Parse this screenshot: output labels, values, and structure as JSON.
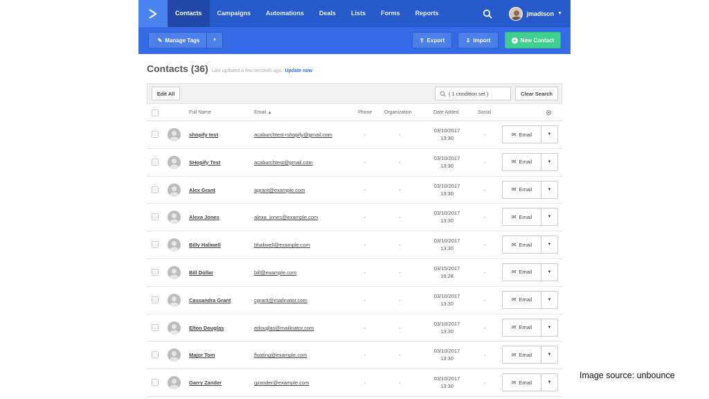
{
  "nav": {
    "items": [
      "Contacts",
      "Campaigns",
      "Automations",
      "Deals",
      "Lists",
      "Forms",
      "Reports"
    ],
    "active": "Contacts",
    "username": "jmadison"
  },
  "toolbar": {
    "manage_tags": "Manage Tags",
    "export": "Export",
    "import": "Import",
    "new_contact": "New Contact"
  },
  "page": {
    "title": "Contacts (36)",
    "updated": "Last updated a few seconds ago.",
    "update_link": "Update now"
  },
  "filter": {
    "edit_all": "Edit All",
    "condition": "( 1 condition set )",
    "clear_search": "Clear Search"
  },
  "columns": {
    "full_name": "Full Name",
    "email": "Email",
    "phone": "Phone",
    "organization": "Organization",
    "date_added": "Date Added",
    "social": "Social"
  },
  "email_button_label": "Email",
  "rows": [
    {
      "name": "shopify test",
      "email": "acaburchtest+shopify@gmail.com",
      "phone": "-",
      "org": "-",
      "date": "03/10/2017",
      "time": "13:30",
      "social": "-"
    },
    {
      "name": "SHopify Test",
      "email": "acaburchtest@gmail.com",
      "phone": "-",
      "org": "-",
      "date": "03/10/2017",
      "time": "13:30",
      "social": "-"
    },
    {
      "name": "Alex Grant",
      "email": "agrant@example.com",
      "phone": "-",
      "org": "-",
      "date": "03/10/2017",
      "time": "13:30",
      "social": "-"
    },
    {
      "name": "Alexa Jones",
      "email": "alexa_jones@example.com",
      "phone": "-",
      "org": "-",
      "date": "03/10/2017",
      "time": "13:30",
      "social": "-"
    },
    {
      "name": "Billy Haliwell",
      "email": "bhaliwell@example.com",
      "phone": "-",
      "org": "-",
      "date": "03/10/2017",
      "time": "13:30",
      "social": "-"
    },
    {
      "name": "Bill Dollar",
      "email": "bill@example.com",
      "phone": "-",
      "org": "-",
      "date": "03/15/2017",
      "time": "16:28",
      "social": "-"
    },
    {
      "name": "Cassandra Grant",
      "email": "cgrant@mailinator.com",
      "phone": "-",
      "org": "-",
      "date": "03/10/2017",
      "time": "13:30",
      "social": "-"
    },
    {
      "name": "Elton Douglas",
      "email": "edouglas@mailinator.com",
      "phone": "-",
      "org": "-",
      "date": "03/10/2017",
      "time": "13:30",
      "social": "-"
    },
    {
      "name": "Major Tom",
      "email": "floating@example.com",
      "phone": "-",
      "org": "-",
      "date": "03/10/2017",
      "time": "13:30",
      "social": "-"
    },
    {
      "name": "Garry Zander",
      "email": "gzander@example.com",
      "phone": "-",
      "org": "-",
      "date": "03/10/2017",
      "time": "13:30",
      "social": "-"
    }
  ],
  "credit": "Image source: unbounce",
  "colors": {
    "nav_bg": "#2659c9",
    "header_bg": "#356ae6",
    "accent_green": "#3fcf8e",
    "link_blue": "#2f6fe6"
  }
}
